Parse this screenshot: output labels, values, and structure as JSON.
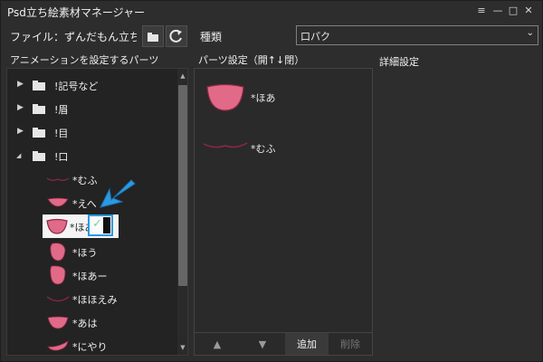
{
  "window": {
    "title": "Psd立ち絵素材マネージャー"
  },
  "toolbar": {
    "file_label": "ファイル：ずんだもん立ち絵素材"
  },
  "kind": {
    "label": "種類",
    "value": "口パク"
  },
  "panels": {
    "left_header": "アニメーションを設定するパーツ",
    "middle_header": "パーツ設定（開↑↓閉）",
    "right_header": "詳細設定"
  },
  "tree": {
    "folders": [
      "!記号など",
      "!眉",
      "!目",
      "!口"
    ],
    "items": [
      "*むふ",
      "*えへ",
      "*ほあ",
      "*ほう",
      "*ほあー",
      "*ほほえみ",
      "*あは",
      "*にやり"
    ]
  },
  "parts": {
    "items": [
      "*ほあ",
      "*むふ"
    ],
    "buttons": {
      "up": "▲",
      "down": "▼",
      "add": "追加",
      "delete": "削除"
    }
  },
  "colors": {
    "lip": "#e06a88",
    "lip_dark": "#8f2844",
    "accent": "#2a9be0",
    "check": "#7ad3a4"
  }
}
